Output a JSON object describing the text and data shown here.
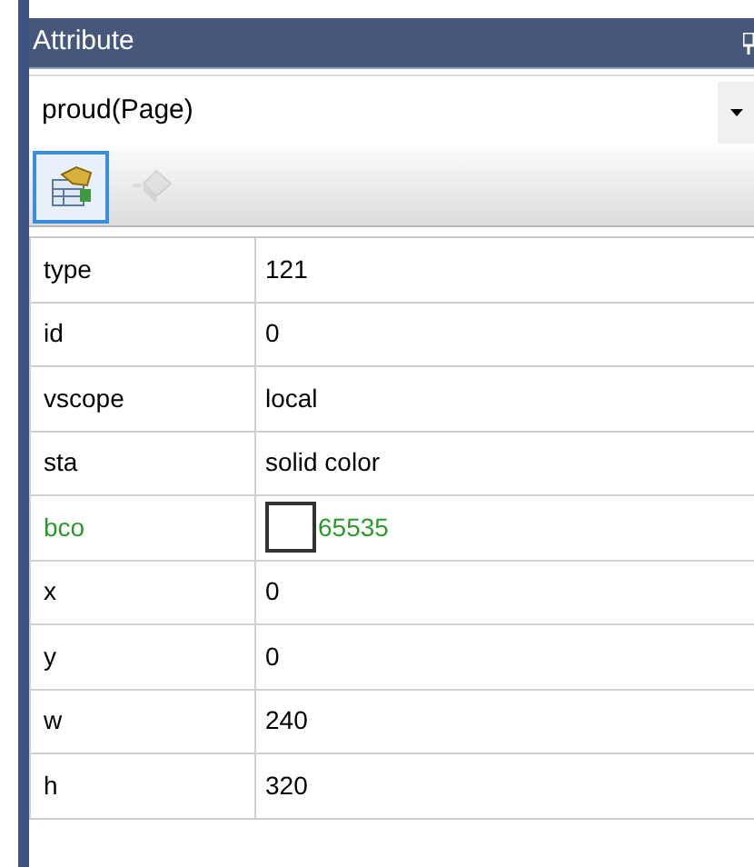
{
  "panel": {
    "title": "Attribute"
  },
  "object_dropdown": {
    "value": "proud(Page)"
  },
  "toolbar": [
    {
      "kind": "properties",
      "selected": true,
      "disabled": false
    },
    {
      "kind": "events",
      "selected": false,
      "disabled": true
    }
  ],
  "properties": [
    {
      "name": "type",
      "value": "121",
      "kind": "text",
      "changed": false
    },
    {
      "name": "id",
      "value": "0",
      "kind": "text",
      "changed": false
    },
    {
      "name": "vscope",
      "value": "local",
      "kind": "text",
      "changed": false
    },
    {
      "name": "sta",
      "value": "solid color",
      "kind": "text",
      "changed": false
    },
    {
      "name": "bco",
      "value": "65535",
      "kind": "color",
      "changed": true
    },
    {
      "name": "x",
      "value": "0",
      "kind": "text",
      "changed": false
    },
    {
      "name": "y",
      "value": "0",
      "kind": "text",
      "changed": false
    },
    {
      "name": "w",
      "value": "240",
      "kind": "text",
      "changed": false
    },
    {
      "name": "h",
      "value": "320",
      "kind": "text",
      "changed": false
    }
  ]
}
